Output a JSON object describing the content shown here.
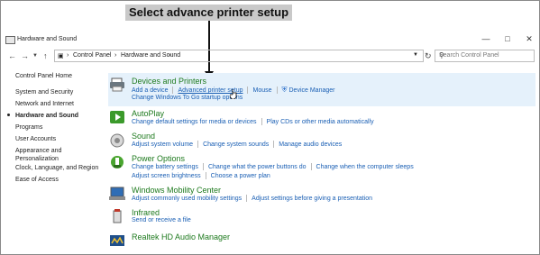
{
  "annotation": {
    "text": "Select advance printer setup"
  },
  "window": {
    "title": "Hardware and Sound"
  },
  "address": {
    "path": [
      "Control Panel",
      "Hardware and Sound"
    ],
    "search_placeholder": "Search Control Panel"
  },
  "sidebar": {
    "items": [
      {
        "label": "Control Panel Home"
      },
      {
        "label": "System and Security"
      },
      {
        "label": "Network and Internet"
      },
      {
        "label": "Hardware and Sound"
      },
      {
        "label": "Programs"
      },
      {
        "label": "User Accounts"
      },
      {
        "label": "Appearance and Personalization"
      },
      {
        "label": "Clock, Language, and Region"
      },
      {
        "label": "Ease of Access"
      }
    ]
  },
  "categories": [
    {
      "title": "Devices and Printers",
      "lines": [
        [
          "Add a device",
          "Advanced printer setup",
          "Mouse",
          "Device Manager"
        ],
        [
          "Change Windows To Go startup options"
        ]
      ]
    },
    {
      "title": "AutoPlay",
      "lines": [
        [
          "Change default settings for media or devices",
          "Play CDs or other media automatically"
        ]
      ]
    },
    {
      "title": "Sound",
      "lines": [
        [
          "Adjust system volume",
          "Change system sounds",
          "Manage audio devices"
        ]
      ]
    },
    {
      "title": "Power Options",
      "lines": [
        [
          "Change battery settings",
          "Change what the power buttons do",
          "Change when the computer sleeps"
        ],
        [
          "Adjust screen brightness",
          "Choose a power plan"
        ]
      ]
    },
    {
      "title": "Windows Mobility Center",
      "lines": [
        [
          "Adjust commonly used mobility settings",
          "Adjust settings before giving a presentation"
        ]
      ]
    },
    {
      "title": "Infrared",
      "lines": [
        [
          "Send or receive a file"
        ]
      ]
    },
    {
      "title": "Realtek HD Audio Manager",
      "lines": []
    }
  ]
}
